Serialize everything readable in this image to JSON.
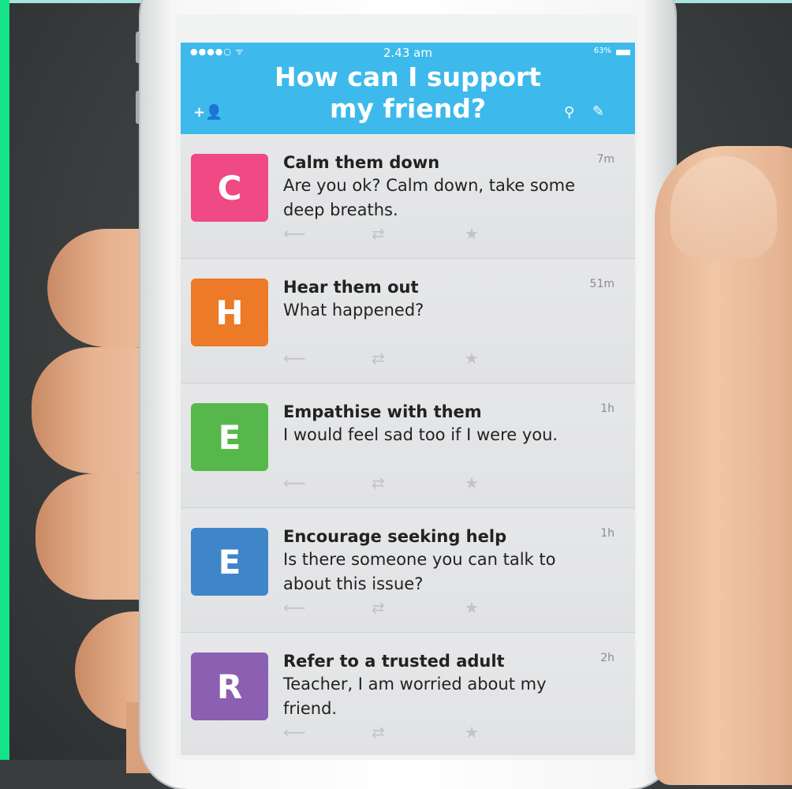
{
  "status_bar": {
    "signal": "●●●●○ ᯤ",
    "time": "2.43 am",
    "battery": "63%"
  },
  "header": {
    "title_line1": "How can I support",
    "title_line2": "my friend?",
    "add_user_icon": "+👤",
    "search_icon": "⚲",
    "compose_icon": "✎"
  },
  "items": [
    {
      "letter": "C",
      "color": "#ef4a83",
      "name": "Calm them down",
      "message": "Are you ok? Calm down, take some deep breaths.",
      "age": "7m"
    },
    {
      "letter": "H",
      "color": "#ec7a26",
      "name": "Hear them out",
      "message": "What happened?",
      "age": "51m"
    },
    {
      "letter": "E",
      "color": "#56b84a",
      "name": "Empathise with them",
      "message": "I would feel sad too if I were you.",
      "age": "1h"
    },
    {
      "letter": "E",
      "color": "#3f86c9",
      "name": "Encourage seeking help",
      "message": "Is there someone you can talk to about this issue?",
      "age": "1h"
    },
    {
      "letter": "R",
      "color": "#8b5fb1",
      "name": "Refer to a trusted adult",
      "message": "Teacher, I am worried about my friend.",
      "age": "2h"
    }
  ],
  "action_icons": {
    "reply": "⟵",
    "retweet": "⇄",
    "favorite": "★"
  }
}
